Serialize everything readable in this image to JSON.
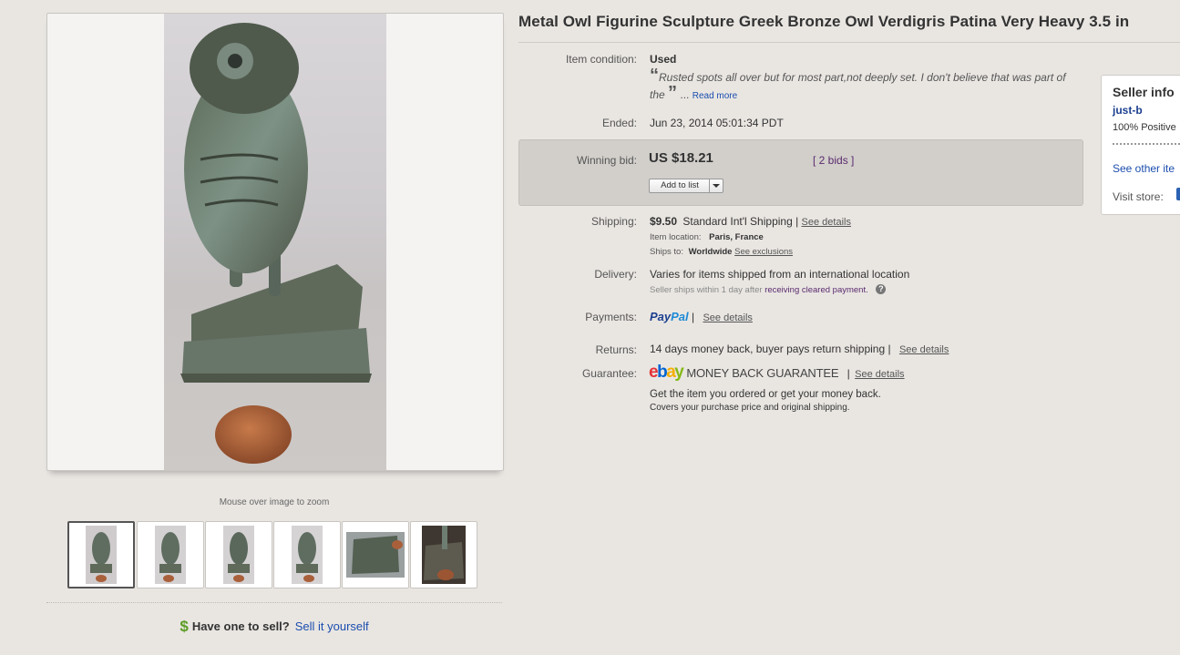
{
  "title": "Metal Owl Figurine Sculpture Greek Bronze Owl Verdigris Patina Very Heavy 3.5 in",
  "gallery": {
    "zoom_hint": "Mouse over image to zoom",
    "thumbnail_count": 6,
    "selected_index": 0
  },
  "sell": {
    "dollar": "$",
    "question": "Have one to sell?",
    "link": "Sell it yourself"
  },
  "details": {
    "condition_label": "Item condition:",
    "condition_value": "Used",
    "condition_note": "Rusted spots all over but for most part,not deeply set. I don't believe that was part of the",
    "read_more": "Read more",
    "ended_label": "Ended:",
    "ended_value": "Jun 23, 2014  05:01:34 PDT",
    "winning_bid_label": "Winning bid:",
    "winning_bid_value": "US $18.21",
    "bids": "[ 2 bids ]",
    "add_to_list": "Add to list",
    "shipping_label": "Shipping:",
    "shipping_cost": "$9.50",
    "shipping_method": "Standard Int'l Shipping |",
    "shipping_see_details": "See details",
    "item_location_label": "Item location:",
    "item_location_value": "Paris, France",
    "ships_to_label": "Ships to:",
    "ships_to_value": "Worldwide",
    "see_exclusions": "See exclusions",
    "delivery_label": "Delivery:",
    "delivery_value": "Varies for items shipped from an international location",
    "delivery_note": "Seller ships within 1 day after",
    "delivery_note_link": "receiving cleared payment.",
    "payments_label": "Payments:",
    "paypal_1": "Pay",
    "paypal_2": "Pal",
    "payments_sep": "|",
    "payments_see_details": "See details",
    "returns_label": "Returns:",
    "returns_value": "14 days money back, buyer pays return shipping |",
    "returns_see_details": "See details",
    "guarantee_label": "Guarantee:",
    "guarantee_mbg": "MONEY BACK GUARANTEE",
    "guarantee_sep": "|",
    "guarantee_see_details": "See details",
    "guarantee_line1": "Get the item you ordered or get your money back.",
    "guarantee_line2": "Covers your purchase price and original shipping."
  },
  "seller": {
    "heading": "Seller info",
    "username": "just-b",
    "positive": "100% Positive",
    "see_other": "See other ite",
    "visit_store": "Visit store:"
  },
  "colors": {
    "link": "#1b4dae",
    "paypal_dark": "#1b3f8f",
    "paypal_light": "#1d8ad6",
    "ebay_e": "#e53238",
    "ebay_b": "#0064d2",
    "ebay_a": "#f5af02",
    "ebay_y": "#86b817"
  }
}
